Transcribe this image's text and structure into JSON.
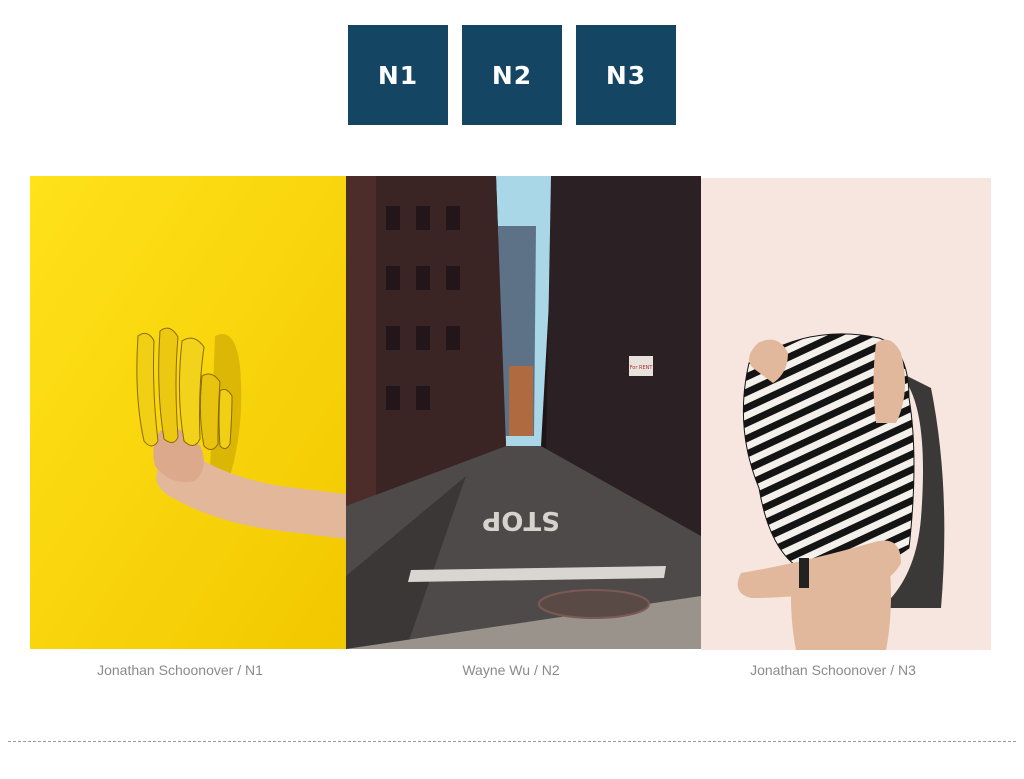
{
  "nav": {
    "items": [
      {
        "label": "N1"
      },
      {
        "label": "N2"
      },
      {
        "label": "N3"
      }
    ],
    "color": "#144664"
  },
  "gallery": {
    "photos": [
      {
        "caption": "Jonathan Schoonover / N1",
        "subject": "hand holding bananas on yellow background",
        "bg": "#fbd600"
      },
      {
        "caption": "Wayne Wu / N2",
        "subject": "city alley with STOP marking",
        "road_text": "STOP",
        "sign_text": "For RENT"
      },
      {
        "caption": "Jonathan Schoonover / N3",
        "subject": "person pulling striped shirt over head",
        "bg": "#f6e6df"
      }
    ]
  }
}
